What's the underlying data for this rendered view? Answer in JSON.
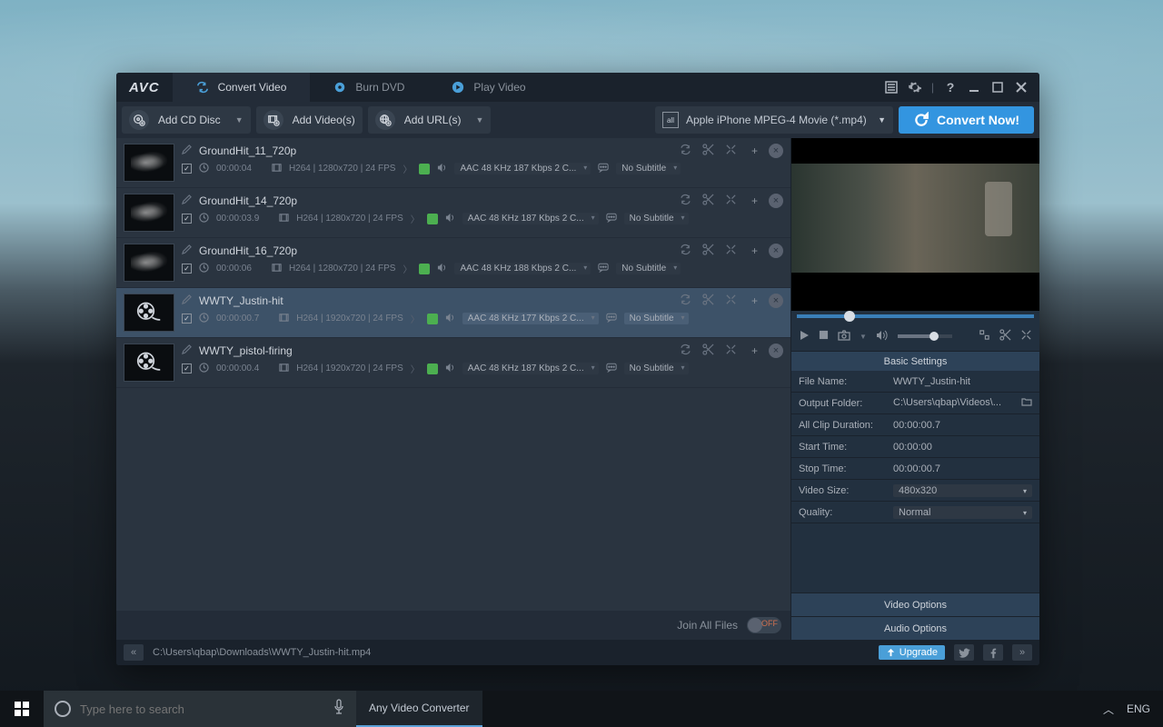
{
  "app": {
    "logo": "AVC"
  },
  "tabs": [
    {
      "label": "Convert Video",
      "active": true
    },
    {
      "label": "Burn DVD",
      "active": false
    },
    {
      "label": "Play Video",
      "active": false
    }
  ],
  "toolbar": {
    "add_cd": "Add CD Disc",
    "add_video": "Add Video(s)",
    "add_url": "Add URL(s)",
    "profile": "Apple iPhone MPEG-4 Movie (*.mp4)",
    "profile_badge": "all",
    "convert": "Convert Now!"
  },
  "files": [
    {
      "name": "GroundHit_11_720p",
      "dur": "00:00:04",
      "vspec": "H264 | 1280x720 | 24 FPS",
      "aspec": "AAC 48 KHz 187 Kbps 2 C...",
      "sub": "No Subtitle",
      "reel": false,
      "sel": false
    },
    {
      "name": "GroundHit_14_720p",
      "dur": "00:00:03.9",
      "vspec": "H264 | 1280x720 | 24 FPS",
      "aspec": "AAC 48 KHz 187 Kbps 2 C...",
      "sub": "No Subtitle",
      "reel": false,
      "sel": false
    },
    {
      "name": "GroundHit_16_720p",
      "dur": "00:00:06",
      "vspec": "H264 | 1280x720 | 24 FPS",
      "aspec": "AAC 48 KHz 188 Kbps 2 C...",
      "sub": "No Subtitle",
      "reel": false,
      "sel": false
    },
    {
      "name": "WWTY_Justin-hit",
      "dur": "00:00:00.7",
      "vspec": "H264 | 1920x720 | 24 FPS",
      "aspec": "AAC 48 KHz 177 Kbps 2 C...",
      "sub": "No Subtitle",
      "reel": true,
      "sel": true
    },
    {
      "name": "WWTY_pistol-firing",
      "dur": "00:00:00.4",
      "vspec": "H264 | 1920x720 | 24 FPS",
      "aspec": "AAC 48 KHz 187 Kbps 2 C...",
      "sub": "No Subtitle",
      "reel": true,
      "sel": false
    }
  ],
  "join": {
    "label": "Join All Files",
    "state": "OFF"
  },
  "settings": {
    "head": "Basic Settings",
    "rows": [
      {
        "k": "File Name:",
        "v": "WWTY_Justin-hit",
        "dd": false
      },
      {
        "k": "Output Folder:",
        "v": "C:\\Users\\qbap\\Videos\\...",
        "dd": false,
        "folder": true
      },
      {
        "k": "All Clip Duration:",
        "v": "00:00:00.7",
        "dd": false
      },
      {
        "k": "Start Time:",
        "v": "00:00:00",
        "dd": false
      },
      {
        "k": "Stop Time:",
        "v": "00:00:00.7",
        "dd": false
      },
      {
        "k": "Video Size:",
        "v": "480x320",
        "dd": true
      },
      {
        "k": "Quality:",
        "v": "Normal",
        "dd": true
      }
    ],
    "video_opts": "Video Options",
    "audio_opts": "Audio Options"
  },
  "footer": {
    "path": "C:\\Users\\qbap\\Downloads\\WWTY_Justin-hit.mp4",
    "upgrade": "Upgrade"
  },
  "taskbar": {
    "search_ph": "Type here to search",
    "app": "Any Video Converter",
    "lang": "ENG"
  }
}
